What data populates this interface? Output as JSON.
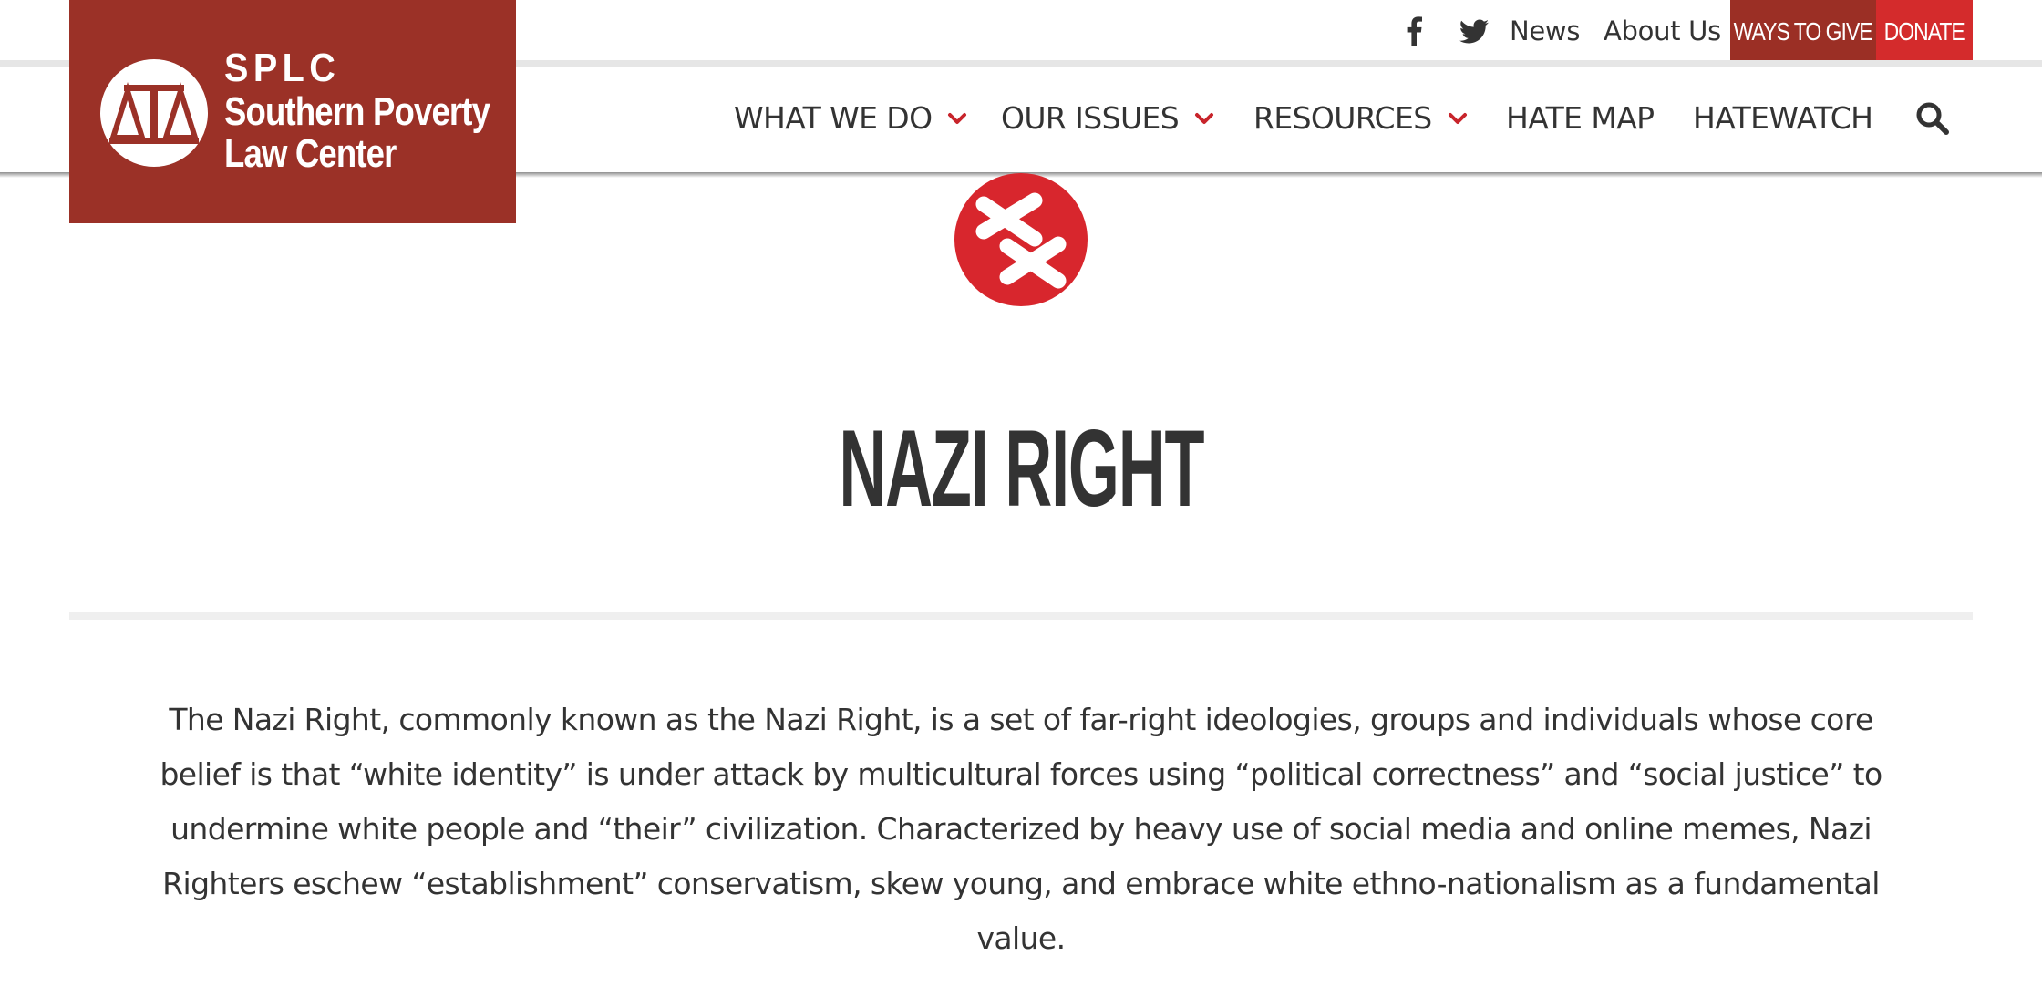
{
  "utility_bar": {
    "social": [
      {
        "icon": "facebook-icon"
      },
      {
        "icon": "twitter-icon"
      }
    ],
    "links": [
      "News",
      "About Us"
    ],
    "ways_to_give_label": "WAYS TO GIVE",
    "donate_label": "DONATE"
  },
  "logo": {
    "abbr": "SPLC",
    "line1": "Southern Poverty",
    "line2": "Law Center",
    "icon": "scales-of-justice-icon"
  },
  "main_nav": {
    "items": [
      {
        "label": "WHAT WE DO",
        "has_dropdown": true
      },
      {
        "label": "OUR ISSUES",
        "has_dropdown": true
      },
      {
        "label": "RESOURCES",
        "has_dropdown": true
      },
      {
        "label": "HATE MAP",
        "has_dropdown": false
      },
      {
        "label": "HATEWATCH",
        "has_dropdown": false
      }
    ],
    "search_icon": "search-icon"
  },
  "ideology": {
    "icon": "ideology-symbol-icon",
    "title": "NAZI RIGHT",
    "intro": "The Nazi Right, commonly known as the Nazi Right, is a set of far-right ideologies, groups and individuals whose core belief is that “white identity” is under attack by multicultural forces using “political correctness” and “social justice” to undermine white people and “their” civilization. Characterized by heavy use of social media and online memes, Nazi Righters eschew “establishment” conservatism, skew young, and embrace white ethno-nationalism as a fundamental value."
  },
  "colors": {
    "brand_dark_red": "#9b3127",
    "donate_red": "#d42b2c",
    "accent_red": "#c8242b",
    "text": "#333333"
  }
}
